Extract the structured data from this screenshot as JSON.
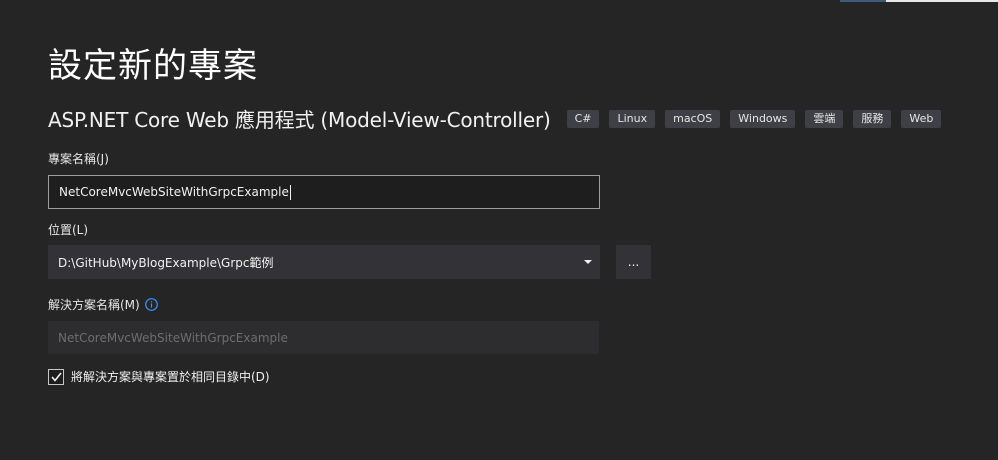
{
  "header": {
    "title": "設定新的專案"
  },
  "template": {
    "name": "ASP.NET Core Web 應用程式 (Model-View-Controller)",
    "tags": [
      "C#",
      "Linux",
      "macOS",
      "Windows",
      "雲端",
      "服務",
      "Web"
    ]
  },
  "project_name": {
    "label": "專案名稱(J)",
    "value": "NetCoreMvcWebSiteWithGrpcExample"
  },
  "location": {
    "label": "位置(L)",
    "value": "D:\\GitHub\\MyBlogExample\\Grpc範例",
    "browse_label": "..."
  },
  "solution_name": {
    "label": "解決方案名稱(M)",
    "placeholder": "NetCoreMvcWebSiteWithGrpcExample",
    "icon": "info-icon"
  },
  "same_directory": {
    "label": "將解決方案與專案置於相同目錄中(D)",
    "checked": true
  },
  "colors": {
    "background": "#252526",
    "tag_background": "#3f3f46",
    "info_accent": "#3794ff"
  }
}
